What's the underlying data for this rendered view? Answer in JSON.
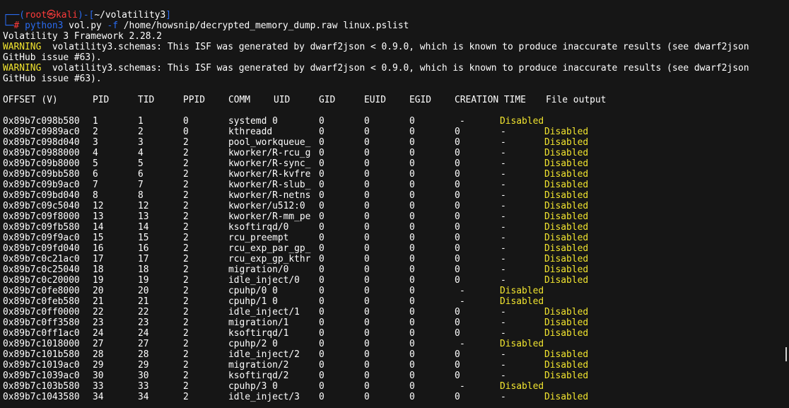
{
  "prompt": {
    "corner_top": "┌──",
    "open": "(",
    "user": "root",
    "at_symbol": "㉿",
    "host": "kali",
    "close": ")",
    "dash": "-",
    "path_open": "[",
    "path": "~/volatility3",
    "path_close": "]",
    "corner_bottom": "└─",
    "hash": "#",
    "command": "python3",
    "args_pre": " vol.py ",
    "flag": "-f",
    "args_post": " /home/howsnip/decrypted_memory_dump.raw linux.pslist"
  },
  "output": {
    "framework": "Volatility 3 Framework 2.28.2",
    "warnings": [
      {
        "label": "WARNING",
        "text": "  volatility3.schemas: This ISF was generated by dwarf2json < 0.9.0, which is known to produce inaccurate results (see dwarf2json",
        "cont": "GitHub issue #63)."
      },
      {
        "label": "WARNING",
        "text": "  volatility3.schemas: This ISF was generated by dwarf2json < 0.9.0, which is known to produce inaccurate results (see dwarf2json",
        "cont": "GitHub issue #63)."
      }
    ]
  },
  "table": {
    "headers": [
      "OFFSET (V)",
      "PID",
      "TID",
      "PPID",
      "COMM",
      "UID",
      "GID",
      "EUID",
      "EGID",
      "CREATION TIME",
      "File output"
    ],
    "rows": [
      {
        "offset": "0x89b7c098b580",
        "pid": "1",
        "tid": "1",
        "ppid": "0",
        "comm": "systemd 0",
        "gid": "0",
        "euid": "0",
        "egid": "0",
        "ctime": "-",
        "file": "Disabled"
      },
      {
        "offset": "0x89b7c0989ac0",
        "pid": "2",
        "tid": "2",
        "ppid": "0",
        "comm": "kthreadd",
        "uid": "0",
        "gid": "0",
        "euid": "0",
        "egid": "0",
        "ctime": "-",
        "file": "Disabled"
      },
      {
        "offset": "0x89b7c098d040",
        "pid": "3",
        "tid": "3",
        "ppid": "2",
        "comm": "pool_workqueue_",
        "uid": "0",
        "gid": "0",
        "euid": "0",
        "egid": "0",
        "ctime": "-",
        "file": "Disabled"
      },
      {
        "offset": "0x89b7c0988000",
        "pid": "4",
        "tid": "4",
        "ppid": "2",
        "comm": "kworker/R-rcu_g",
        "uid": "0",
        "gid": "0",
        "euid": "0",
        "egid": "0",
        "ctime": "-",
        "file": "Disabled"
      },
      {
        "offset": "0x89b7c09b8000",
        "pid": "5",
        "tid": "5",
        "ppid": "2",
        "comm": "kworker/R-sync_",
        "uid": "0",
        "gid": "0",
        "euid": "0",
        "egid": "0",
        "ctime": "-",
        "file": "Disabled"
      },
      {
        "offset": "0x89b7c09bb580",
        "pid": "6",
        "tid": "6",
        "ppid": "2",
        "comm": "kworker/R-kvfre",
        "uid": "0",
        "gid": "0",
        "euid": "0",
        "egid": "0",
        "ctime": "-",
        "file": "Disabled"
      },
      {
        "offset": "0x89b7c09b9ac0",
        "pid": "7",
        "tid": "7",
        "ppid": "2",
        "comm": "kworker/R-slub_",
        "uid": "0",
        "gid": "0",
        "euid": "0",
        "egid": "0",
        "ctime": "-",
        "file": "Disabled"
      },
      {
        "offset": "0x89b7c09bd040",
        "pid": "8",
        "tid": "8",
        "ppid": "2",
        "comm": "kworker/R-netns",
        "uid": "0",
        "gid": "0",
        "euid": "0",
        "egid": "0",
        "ctime": "-",
        "file": "Disabled"
      },
      {
        "offset": "0x89b7c09c5040",
        "pid": "12",
        "tid": "12",
        "ppid": "2",
        "comm": "kworker/u512:0",
        "uid": "0",
        "gid": "0",
        "euid": "0",
        "egid": "0",
        "ctime": "-",
        "file": "Disabled"
      },
      {
        "offset": "0x89b7c09f8000",
        "pid": "13",
        "tid": "13",
        "ppid": "2",
        "comm": "kworker/R-mm_pe",
        "uid": "0",
        "gid": "0",
        "euid": "0",
        "egid": "0",
        "ctime": "-",
        "file": "Disabled"
      },
      {
        "offset": "0x89b7c09fb580",
        "pid": "14",
        "tid": "14",
        "ppid": "2",
        "comm": "ksoftirqd/0",
        "uid": "0",
        "gid": "0",
        "euid": "0",
        "egid": "0",
        "ctime": "-",
        "file": "Disabled"
      },
      {
        "offset": "0x89b7c09f9ac0",
        "pid": "15",
        "tid": "15",
        "ppid": "2",
        "comm": "rcu_preempt",
        "uid": "0",
        "gid": "0",
        "euid": "0",
        "egid": "0",
        "ctime": "-",
        "file": "Disabled"
      },
      {
        "offset": "0x89b7c09fd040",
        "pid": "16",
        "tid": "16",
        "ppid": "2",
        "comm": "rcu_exp_par_gp_",
        "uid": "0",
        "gid": "0",
        "euid": "0",
        "egid": "0",
        "ctime": "-",
        "file": "Disabled"
      },
      {
        "offset": "0x89b7c0c21ac0",
        "pid": "17",
        "tid": "17",
        "ppid": "2",
        "comm": "rcu_exp_gp_kthr",
        "uid": "0",
        "gid": "0",
        "euid": "0",
        "egid": "0",
        "ctime": "-",
        "file": "Disabled"
      },
      {
        "offset": "0x89b7c0c25040",
        "pid": "18",
        "tid": "18",
        "ppid": "2",
        "comm": "migration/0",
        "uid": "0",
        "gid": "0",
        "euid": "0",
        "egid": "0",
        "ctime": "-",
        "file": "Disabled"
      },
      {
        "offset": "0x89b7c0c20000",
        "pid": "19",
        "tid": "19",
        "ppid": "2",
        "comm": "idle_inject/0",
        "uid": "0",
        "gid": "0",
        "euid": "0",
        "egid": "0",
        "ctime": "-",
        "file": "Disabled"
      },
      {
        "offset": "0x89b7c0fe8000",
        "pid": "20",
        "tid": "20",
        "ppid": "2",
        "comm": "cpuhp/0 0",
        "gid": "0",
        "euid": "0",
        "egid": "0",
        "ctime": "-",
        "file": "Disabled"
      },
      {
        "offset": "0x89b7c0feb580",
        "pid": "21",
        "tid": "21",
        "ppid": "2",
        "comm": "cpuhp/1 0",
        "gid": "0",
        "euid": "0",
        "egid": "0",
        "ctime": "-",
        "file": "Disabled"
      },
      {
        "offset": "0x89b7c0ff0000",
        "pid": "22",
        "tid": "22",
        "ppid": "2",
        "comm": "idle_inject/1",
        "uid": "0",
        "gid": "0",
        "euid": "0",
        "egid": "0",
        "ctime": "-",
        "file": "Disabled"
      },
      {
        "offset": "0x89b7c0ff3580",
        "pid": "23",
        "tid": "23",
        "ppid": "2",
        "comm": "migration/1",
        "uid": "0",
        "gid": "0",
        "euid": "0",
        "egid": "0",
        "ctime": "-",
        "file": "Disabled"
      },
      {
        "offset": "0x89b7c0ff1ac0",
        "pid": "24",
        "tid": "24",
        "ppid": "2",
        "comm": "ksoftirqd/1",
        "uid": "0",
        "gid": "0",
        "euid": "0",
        "egid": "0",
        "ctime": "-",
        "file": "Disabled"
      },
      {
        "offset": "0x89b7c1018000",
        "pid": "27",
        "tid": "27",
        "ppid": "2",
        "comm": "cpuhp/2 0",
        "gid": "0",
        "euid": "0",
        "egid": "0",
        "ctime": "-",
        "file": "Disabled"
      },
      {
        "offset": "0x89b7c101b580",
        "pid": "28",
        "tid": "28",
        "ppid": "2",
        "comm": "idle_inject/2",
        "uid": "0",
        "gid": "0",
        "euid": "0",
        "egid": "0",
        "ctime": "-",
        "file": "Disabled"
      },
      {
        "offset": "0x89b7c1019ac0",
        "pid": "29",
        "tid": "29",
        "ppid": "2",
        "comm": "migration/2",
        "uid": "0",
        "gid": "0",
        "euid": "0",
        "egid": "0",
        "ctime": "-",
        "file": "Disabled"
      },
      {
        "offset": "0x89b7c1039ac0",
        "pid": "30",
        "tid": "30",
        "ppid": "2",
        "comm": "ksoftirqd/2",
        "uid": "0",
        "gid": "0",
        "euid": "0",
        "egid": "0",
        "ctime": "-",
        "file": "Disabled"
      },
      {
        "offset": "0x89b7c103b580",
        "pid": "33",
        "tid": "33",
        "ppid": "2",
        "comm": "cpuhp/3 0",
        "gid": "0",
        "euid": "0",
        "egid": "0",
        "ctime": "-",
        "file": "Disabled"
      },
      {
        "offset": "0x89b7c1043580",
        "pid": "34",
        "tid": "34",
        "ppid": "2",
        "comm": "idle_inject/3",
        "uid": "0",
        "gid": "0",
        "euid": "0",
        "egid": "0",
        "ctime": "-",
        "file": "Disabled"
      }
    ]
  },
  "colors": {
    "background": "#161616",
    "prompt_blue": "#2a6bf0",
    "prompt_red": "#ff3b3b",
    "warning_yellow": "#f2e52f",
    "text": "#ffffff"
  }
}
